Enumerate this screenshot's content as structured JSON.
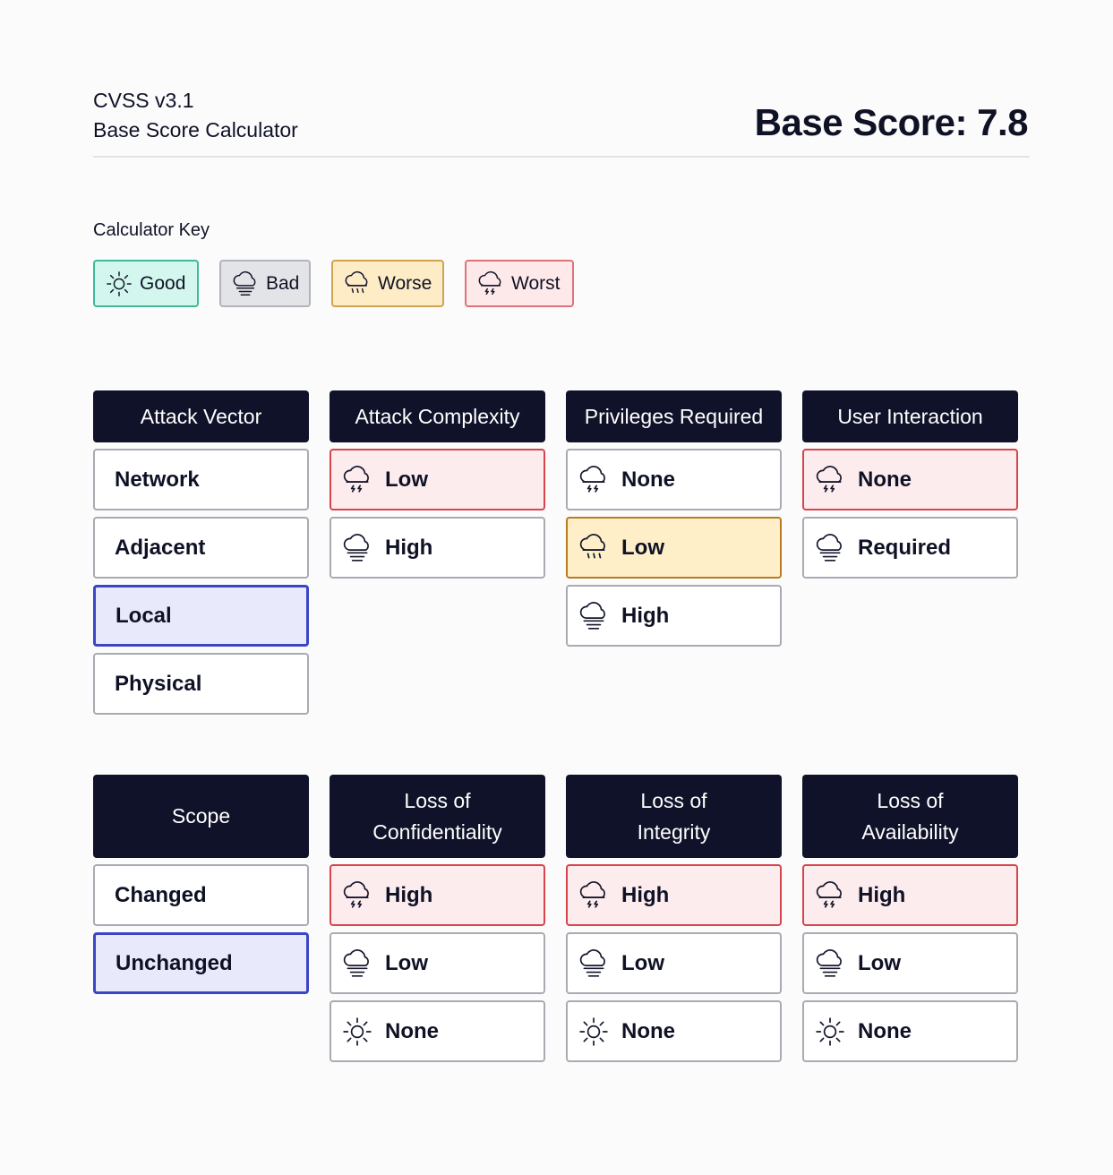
{
  "header": {
    "title_line1": "CVSS v3.1",
    "title_line2": "Base Score Calculator",
    "score": "Base Score: 7.8"
  },
  "key": {
    "heading": "Calculator Key",
    "items": [
      {
        "label": "Good",
        "icon": "sun-icon",
        "color": "#d3f7ee"
      },
      {
        "label": "Bad",
        "icon": "cloud-fog-icon",
        "color": "#e3e4e8"
      },
      {
        "label": "Worse",
        "icon": "cloud-rain-icon",
        "color": "#fdecc6"
      },
      {
        "label": "Worst",
        "icon": "cloud-storm-icon",
        "color": "#fde9ea"
      }
    ]
  },
  "metrics": [
    {
      "title": "Attack Vector",
      "options": [
        {
          "label": "Network",
          "icon": "",
          "state": "default"
        },
        {
          "label": "Adjacent",
          "icon": "",
          "state": "default"
        },
        {
          "label": "Local",
          "icon": "",
          "state": "selected"
        },
        {
          "label": "Physical",
          "icon": "",
          "state": "default"
        }
      ]
    },
    {
      "title": "Attack Complexity",
      "options": [
        {
          "label": "Low",
          "icon": "cloud-storm-icon",
          "state": "worst"
        },
        {
          "label": "High",
          "icon": "cloud-fog-icon",
          "state": "default"
        }
      ]
    },
    {
      "title": "Privileges Required",
      "options": [
        {
          "label": "None",
          "icon": "cloud-storm-icon",
          "state": "default"
        },
        {
          "label": "Low",
          "icon": "cloud-rain-icon",
          "state": "worse"
        },
        {
          "label": "High",
          "icon": "cloud-fog-icon",
          "state": "default"
        }
      ]
    },
    {
      "title": "User Interaction",
      "options": [
        {
          "label": "None",
          "icon": "cloud-storm-icon",
          "state": "worst"
        },
        {
          "label": "Required",
          "icon": "cloud-fog-icon",
          "state": "default"
        }
      ]
    },
    {
      "title": "Scope",
      "options": [
        {
          "label": "Changed",
          "icon": "",
          "state": "default"
        },
        {
          "label": "Unchanged",
          "icon": "",
          "state": "selected"
        }
      ]
    },
    {
      "title_line1": "Loss of",
      "title_line2": "Confidentiality",
      "options": [
        {
          "label": "High",
          "icon": "cloud-storm-icon",
          "state": "worst"
        },
        {
          "label": "Low",
          "icon": "cloud-fog-icon",
          "state": "default"
        },
        {
          "label": "None",
          "icon": "sun-icon",
          "state": "default"
        }
      ]
    },
    {
      "title_line1": "Loss of",
      "title_line2": "Integrity",
      "options": [
        {
          "label": "High",
          "icon": "cloud-storm-icon",
          "state": "worst"
        },
        {
          "label": "Low",
          "icon": "cloud-fog-icon",
          "state": "default"
        },
        {
          "label": "None",
          "icon": "sun-icon",
          "state": "default"
        }
      ]
    },
    {
      "title_line1": "Loss of",
      "title_line2": "Availability",
      "options": [
        {
          "label": "High",
          "icon": "cloud-storm-icon",
          "state": "worst"
        },
        {
          "label": "Low",
          "icon": "cloud-fog-icon",
          "state": "default"
        },
        {
          "label": "None",
          "icon": "sun-icon",
          "state": "default"
        }
      ]
    }
  ]
}
